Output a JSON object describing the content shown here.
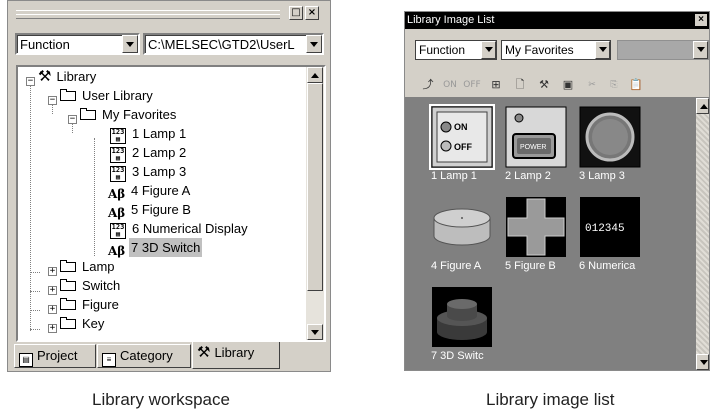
{
  "workspace": {
    "caption": "Library workspace",
    "function_combo": "Function",
    "path_combo": "C:\\MELSEC\\GTD2\\UserL",
    "tree": [
      {
        "label": "Library",
        "icon": "library-tools-icon"
      },
      {
        "label": "User Library",
        "icon": "folder-icon"
      },
      {
        "label": "My Favorites",
        "icon": "favorites-folder-icon"
      },
      {
        "label": "1 Lamp 1",
        "icon": "numeric-object-icon"
      },
      {
        "label": "2 Lamp 2",
        "icon": "numeric-object-icon"
      },
      {
        "label": "3 Lamp 3",
        "icon": "numeric-object-icon"
      },
      {
        "label": "4 Figure A",
        "icon": "figure-object-icon"
      },
      {
        "label": "5 Figure B",
        "icon": "figure-object-icon"
      },
      {
        "label": "6 Numerical Display",
        "icon": "numeric-object-icon"
      },
      {
        "label": "7 3D Switch",
        "icon": "figure-object-icon"
      },
      {
        "label": "Lamp",
        "icon": "folder-icon"
      },
      {
        "label": "Switch",
        "icon": "folder-icon"
      },
      {
        "label": "Figure",
        "icon": "folder-icon"
      },
      {
        "label": "Key",
        "icon": "folder-icon"
      }
    ],
    "tabs": [
      "Project",
      "Category",
      "Library"
    ]
  },
  "image_list": {
    "caption": "Library image list",
    "title": "Library Image List",
    "function_combo": "Function",
    "favorites_combo": "My Favorites",
    "toolbar": {
      "on": "ON",
      "off": "OFF"
    },
    "items": [
      {
        "label": "1 Lamp 1"
      },
      {
        "label": "2 Lamp 2"
      },
      {
        "label": "3 Lamp 3"
      },
      {
        "label": "4 Figure A"
      },
      {
        "label": "5 Figure B"
      },
      {
        "label": "6 Numerica",
        "display": "012345"
      },
      {
        "label": "7 3D Switc"
      }
    ],
    "switch_text": {
      "on": "ON",
      "off": "OFF",
      "power": "POWER"
    }
  }
}
